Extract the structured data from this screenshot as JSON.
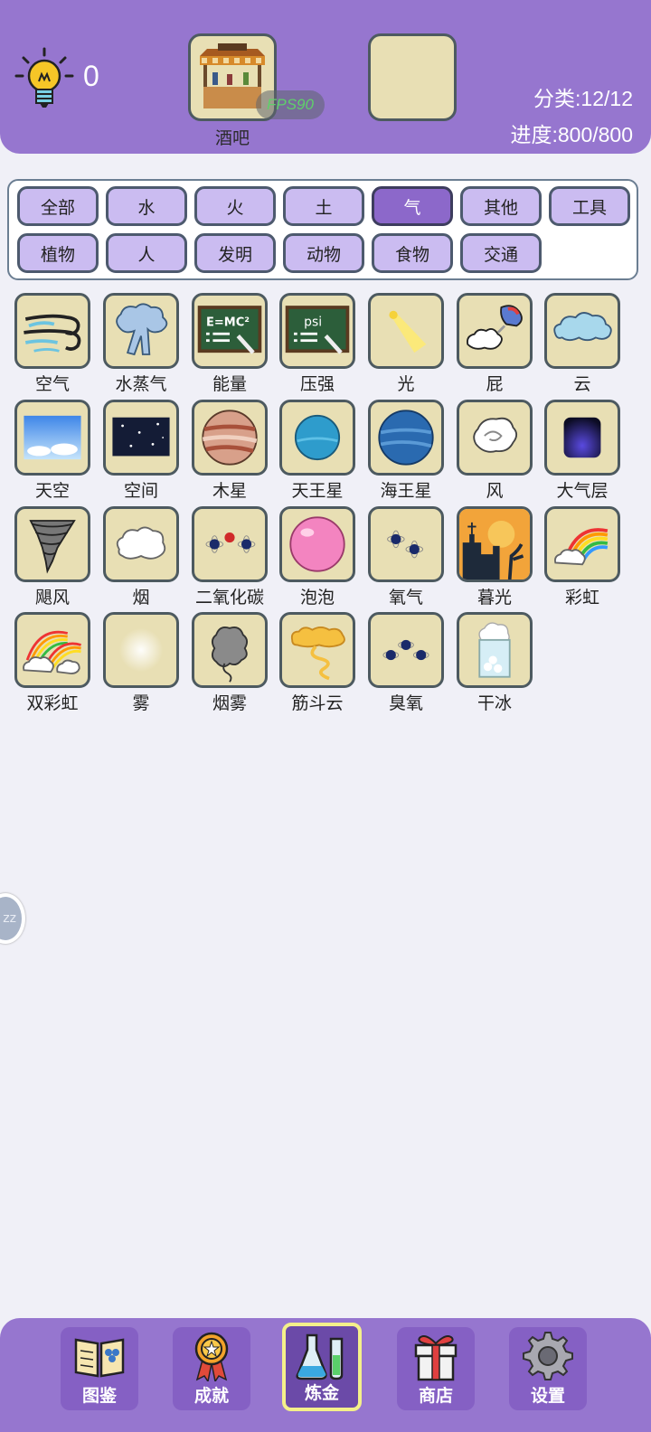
{
  "header": {
    "hint_count": "0",
    "slot_a_label": "酒吧",
    "fps_text": "FPS90",
    "category_progress": "分类:12/12",
    "overall_progress": "进度:800/800"
  },
  "categories": {
    "row1": [
      "全部",
      "水",
      "火",
      "土",
      "气",
      "其他",
      "工具"
    ],
    "row2": [
      "植物",
      "人",
      "发明",
      "动物",
      "食物",
      "交通"
    ],
    "active": "气"
  },
  "elements": [
    {
      "label": "空气",
      "icon": "wind-air-icon"
    },
    {
      "label": "水蒸气",
      "icon": "steam-cloud-icon"
    },
    {
      "label": "能量",
      "icon": "blackboard-emc2-icon"
    },
    {
      "label": "压强",
      "icon": "blackboard-psi-icon"
    },
    {
      "label": "光",
      "icon": "light-beam-icon"
    },
    {
      "label": "屁",
      "icon": "fart-cloud-icon"
    },
    {
      "label": "云",
      "icon": "cloud-icon"
    },
    {
      "label": "天空",
      "icon": "sky-icon"
    },
    {
      "label": "空间",
      "icon": "space-icon"
    },
    {
      "label": "木星",
      "icon": "jupiter-icon"
    },
    {
      "label": "天王星",
      "icon": "uranus-icon"
    },
    {
      "label": "海王星",
      "icon": "neptune-icon"
    },
    {
      "label": "风",
      "icon": "wind-swirl-icon"
    },
    {
      "label": "大气层",
      "icon": "atmosphere-icon"
    },
    {
      "label": "飓风",
      "icon": "tornado-icon"
    },
    {
      "label": "烟",
      "icon": "smoke-icon"
    },
    {
      "label": "二氧化碳",
      "icon": "co2-molecule-icon"
    },
    {
      "label": "泡泡",
      "icon": "bubble-icon"
    },
    {
      "label": "氧气",
      "icon": "oxygen-molecule-icon"
    },
    {
      "label": "暮光",
      "icon": "twilight-icon"
    },
    {
      "label": "彩虹",
      "icon": "rainbow-icon"
    },
    {
      "label": "双彩虹",
      "icon": "double-rainbow-icon"
    },
    {
      "label": "雾",
      "icon": "fog-icon"
    },
    {
      "label": "烟雾",
      "icon": "smog-icon"
    },
    {
      "label": "筋斗云",
      "icon": "somersault-cloud-icon"
    },
    {
      "label": "臭氧",
      "icon": "ozone-molecule-icon"
    },
    {
      "label": "干冰",
      "icon": "dry-ice-icon"
    }
  ],
  "nav": {
    "items": [
      {
        "label": "图鉴",
        "icon": "book-icon"
      },
      {
        "label": "成就",
        "icon": "medal-icon"
      },
      {
        "label": "炼金",
        "icon": "flask-icon"
      },
      {
        "label": "商店",
        "icon": "gift-box-icon"
      },
      {
        "label": "设置",
        "icon": "gear-icon"
      }
    ],
    "active": "炼金"
  },
  "float_button": {
    "text": "zz"
  },
  "colors": {
    "header_bg": "#9676cf",
    "page_bg": "#f0f0f7",
    "tile_bg": "#e8dfb4",
    "category_bg": "#cbbcf1",
    "category_active_bg": "#8c68ca",
    "nav_active_border": "#f4f08a"
  }
}
